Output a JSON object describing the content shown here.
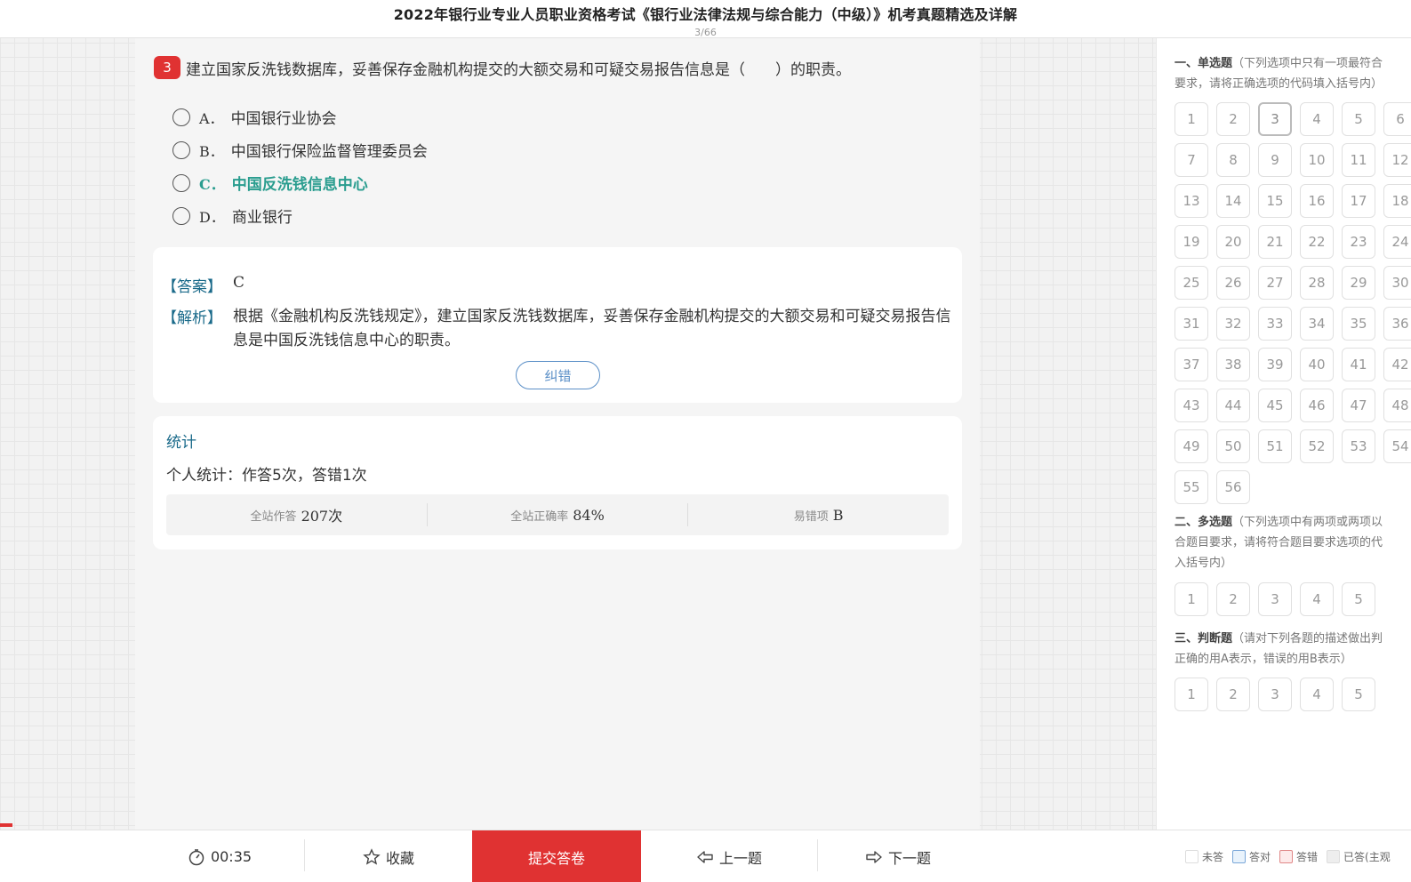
{
  "header": {
    "title": "2022年银行业专业人员职业资格考试《银行业法律法规与综合能力（中级）》机考真题精选及详解",
    "progress": "3/66"
  },
  "question": {
    "number": "3",
    "text": "建立国家反洗钱数据库，妥善保存金融机构提交的大额交易和可疑交易报告信息是（　　）的职责。",
    "options": [
      {
        "letter": "A．",
        "text": "中国银行业协会"
      },
      {
        "letter": "B．",
        "text": "中国银行保险监督管理委员会"
      },
      {
        "letter": "C．",
        "text": "中国反洗钱信息中心"
      },
      {
        "letter": "D．",
        "text": "商业银行"
      }
    ]
  },
  "answer": {
    "answer_tag": "【答案】",
    "answer_value": "C",
    "analysis_tag": "【解析】",
    "analysis_text": "根据《金融机构反洗钱规定》，建立国家反洗钱数据库，妥善保存金融机构提交的大额交易和可疑交易报告信息是中国反洗钱信息中心的职责。",
    "fix_button": "纠错"
  },
  "stats": {
    "title": "统计",
    "personal": "个人统计：作答5次，答错1次",
    "total_label": "全站作答",
    "total_value": "207次",
    "rate_label": "全站正确率",
    "rate_value": "84%",
    "wrong_label": "易错项",
    "wrong_value": "B"
  },
  "sidebar": {
    "single_title": "一、单选题",
    "single_desc_1": "（下列选项中只有一项最符合",
    "single_desc_2": "要求，请将正确选项的代码填入括号内）",
    "single_numbers": [
      "1",
      "2",
      "3",
      "4",
      "5",
      "6",
      "7",
      "8",
      "9",
      "10",
      "11",
      "12",
      "13",
      "14",
      "15",
      "16",
      "17",
      "18",
      "19",
      "20",
      "21",
      "22",
      "23",
      "24",
      "25",
      "26",
      "27",
      "28",
      "29",
      "30",
      "31",
      "32",
      "33",
      "34",
      "35",
      "36",
      "37",
      "38",
      "39",
      "40",
      "41",
      "42",
      "43",
      "44",
      "45",
      "46",
      "47",
      "48",
      "49",
      "50",
      "51",
      "52",
      "53",
      "54",
      "55",
      "56"
    ],
    "current": "3",
    "multi_title": "二、多选题",
    "multi_desc_1": "（下列选项中有两项或两项以",
    "multi_desc_2": "合题目要求，请将符合题目要求选项的代",
    "multi_desc_3": "入括号内）",
    "multi_numbers": [
      "1",
      "2",
      "3",
      "4",
      "5"
    ],
    "judge_title": "三、判断题",
    "judge_desc_1": "（请对下列各题的描述做出判",
    "judge_desc_2": "正确的用A表示，错误的用B表示）",
    "judge_numbers": [
      "1",
      "2",
      "3",
      "4",
      "5"
    ]
  },
  "bottom": {
    "timer": "00:35",
    "favorite": "收藏",
    "submit": "提交答卷",
    "prev": "上一题",
    "next": "下一题",
    "legend": {
      "unanswered": "未答",
      "correct": "答对",
      "wrong": "答错",
      "answered": "已答(主观"
    }
  },
  "colors": {
    "accent_red": "#e03232",
    "correct_green": "#2a9d8f",
    "tag_blue": "#1a6a8a"
  }
}
